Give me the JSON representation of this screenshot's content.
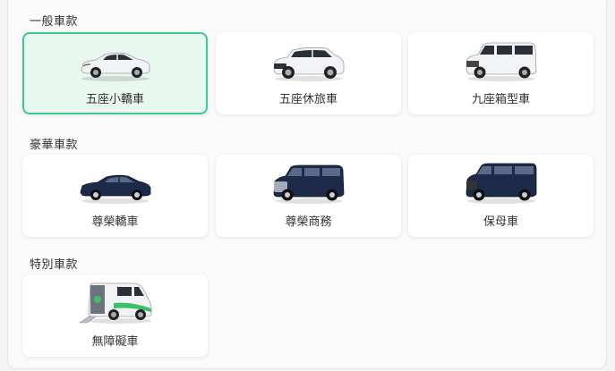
{
  "sections": [
    {
      "title": "一般車款",
      "items": [
        {
          "label": "五座小轎車",
          "selected": true,
          "icon": "sedan-white-icon"
        },
        {
          "label": "五座休旅車",
          "selected": false,
          "icon": "suv-white-icon"
        },
        {
          "label": "九座箱型車",
          "selected": false,
          "icon": "van-white-icon"
        }
      ]
    },
    {
      "title": "豪華車款",
      "items": [
        {
          "label": "尊榮轎車",
          "selected": false,
          "icon": "luxury-sedan-navy-icon"
        },
        {
          "label": "尊榮商務",
          "selected": false,
          "icon": "luxury-mpv-navy-icon"
        },
        {
          "label": "保母車",
          "selected": false,
          "icon": "nanny-van-navy-icon"
        }
      ]
    },
    {
      "title": "特別車款",
      "items": [
        {
          "label": "無障礙車",
          "selected": false,
          "icon": "accessible-van-icon"
        }
      ]
    }
  ],
  "colors": {
    "selected_border": "#3fc79a",
    "selected_bg": "#e9f8ef",
    "car_white": "#f2f3f5",
    "car_navy": "#1e2a4a",
    "accessible_accent": "#3dbf6a"
  }
}
